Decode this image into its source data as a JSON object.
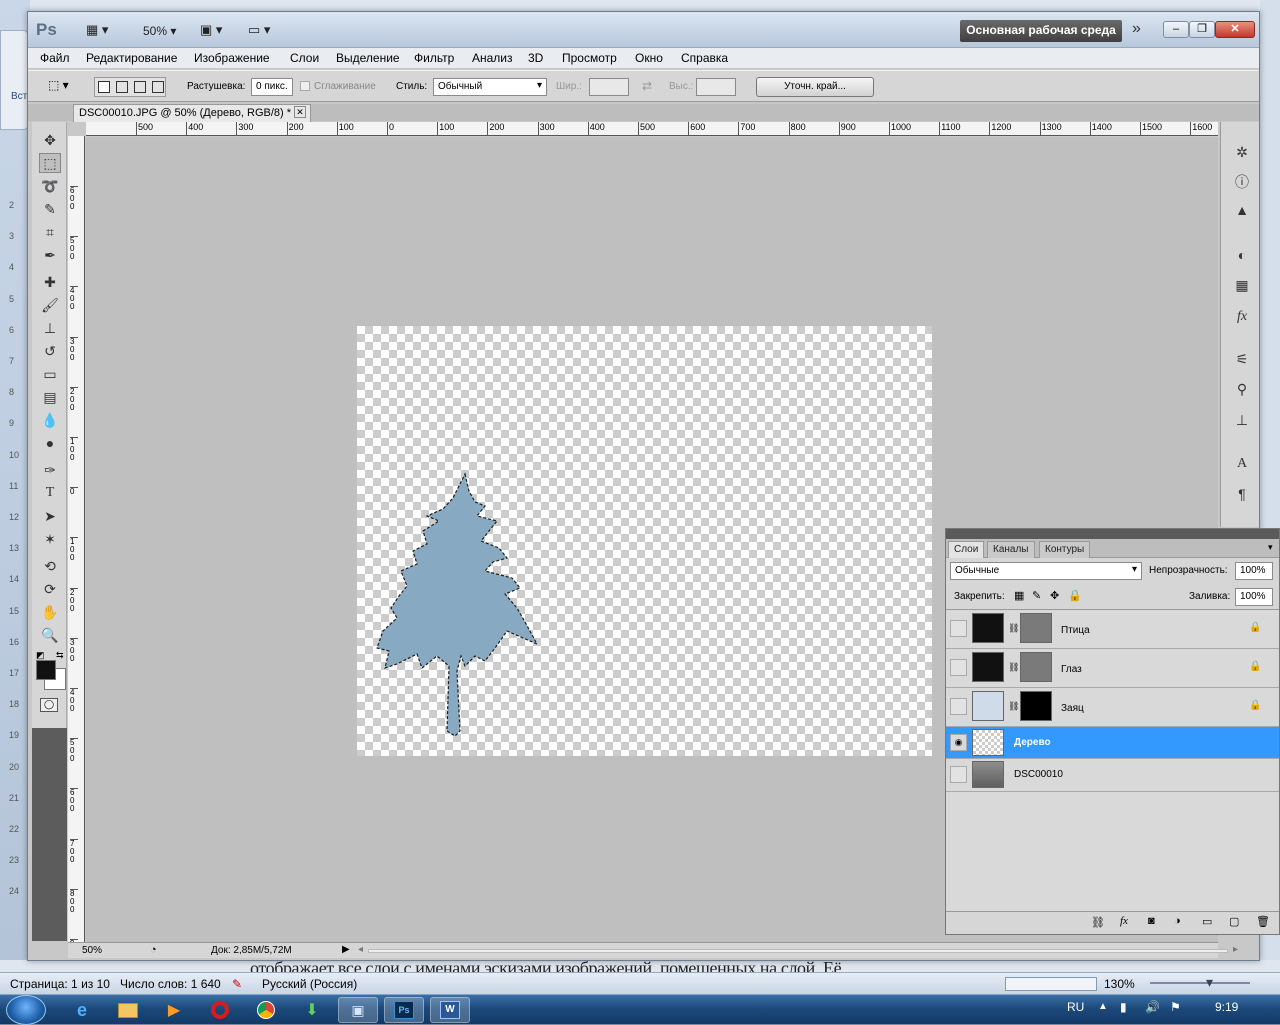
{
  "ps": {
    "logo": "Ps",
    "zoom_combo": "50%",
    "workspace_button": "Основная рабочая среда",
    "menu": [
      "Файл",
      "Редактирование",
      "Изображение",
      "Слои",
      "Выделение",
      "Фильтр",
      "Анализ",
      "3D",
      "Просмотр",
      "Окно",
      "Справка"
    ],
    "options": {
      "feather_label": "Растушевка:",
      "feather_value": "0 пикс.",
      "antialias_label": "Сглаживание",
      "style_label": "Стиль:",
      "style_value": "Обычный",
      "width_label": "Шир.:",
      "height_label": "Выс.:",
      "refine_edge": "Уточн. край..."
    },
    "doc_tab": "DSC00010.JPG @ 50% (Дерево, RGB/8) *",
    "ruler_top": [
      "500",
      "400",
      "300",
      "200",
      "100",
      "0",
      "100",
      "200",
      "300",
      "400",
      "500",
      "600",
      "700",
      "800",
      "900",
      "1000",
      "1100",
      "1200",
      "1300",
      "1400",
      "1500",
      "1600"
    ],
    "ruler_left": [
      "2",
      "3",
      "4",
      "5",
      "6",
      "7",
      "8",
      "9",
      "10",
      "11",
      "12",
      "13",
      "14",
      "15",
      "16",
      "17",
      "18",
      "19",
      "20",
      "21",
      "22",
      "23",
      "24"
    ],
    "ruler_left_vertical": [
      "600",
      "500",
      "400",
      "300",
      "200",
      "100",
      "0",
      "100",
      "200",
      "300",
      "400",
      "500",
      "600",
      "700",
      "800",
      "900",
      "1000",
      "1100"
    ],
    "status_zoom": "50%",
    "status_doc": "Док: 2,85M/5,72M"
  },
  "layers_panel": {
    "tabs": [
      "Слои",
      "Каналы",
      "Контуры"
    ],
    "blend_mode": "Обычные",
    "opacity_label": "Непрозрачность:",
    "opacity_value": "100%",
    "lock_label": "Закрепить:",
    "fill_label": "Заливка:",
    "fill_value": "100%",
    "layers": [
      {
        "name": "Птица",
        "visible": false,
        "locked": true,
        "selected": false
      },
      {
        "name": "Глаз",
        "visible": false,
        "locked": true,
        "selected": false
      },
      {
        "name": "Заяц",
        "visible": false,
        "locked": true,
        "selected": false
      },
      {
        "name": "Дерево",
        "visible": true,
        "locked": false,
        "selected": true
      },
      {
        "name": "DSC00010",
        "visible": false,
        "locked": false,
        "selected": false
      }
    ],
    "footer_icons": [
      "link-icon",
      "fx-icon",
      "mask-icon",
      "adjustment-icon",
      "folder-icon",
      "new-layer-icon",
      "trash-icon"
    ]
  },
  "word": {
    "status_page": "Страница: 1 из 10",
    "status_words": "Число слов: 1 640",
    "status_lang": "Русский (Россия)",
    "zoom": "130%",
    "doc_text_fragment": "отображает все слои с именами эскизами изображений, помещенных на слой. Её",
    "left_label": "Вст"
  },
  "taskbar": {
    "lang": "RU",
    "time": "9:19"
  },
  "colors": {
    "selected_layer": "#3399ff",
    "tree": "#87a9c1",
    "ps_bg": "#bfbfbf"
  }
}
